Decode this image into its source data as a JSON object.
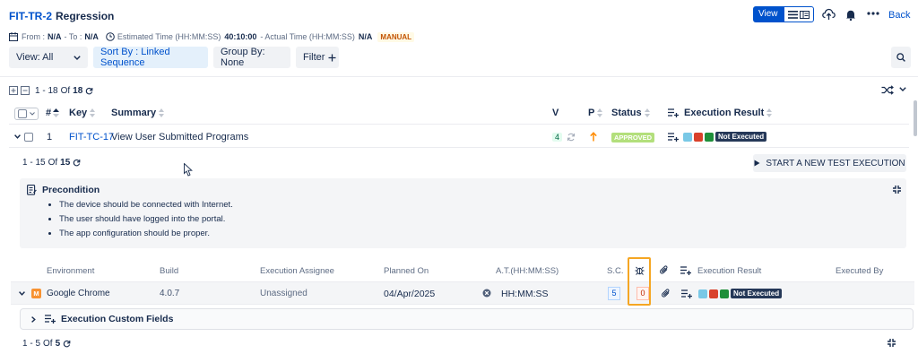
{
  "header": {
    "key": "FIT-TR-2",
    "title": "Regression",
    "from_label": "From :",
    "from_value": "N/A",
    "to_label": "- To :",
    "to_value": "N/A",
    "est_label": "Estimated Time (HH:MM:SS)",
    "est_value": "40:10:00",
    "actual_label": "- Actual Time (HH:MM:SS)",
    "actual_value": "N/A",
    "type_badge": "MANUAL",
    "view_label": "View",
    "back_label": "Back"
  },
  "toolbar": {
    "view_filter": "View: All",
    "sort_by": "Sort By : Linked Sequence",
    "group_by": "Group By: None",
    "filter": "Filter"
  },
  "pagination": {
    "range": "1 - 18",
    "of": "Of",
    "total": "18"
  },
  "columns": {
    "num": "#",
    "key": "Key",
    "summary": "Summary",
    "v": "V",
    "p": "P",
    "status": "Status",
    "execution_result": "Execution Result"
  },
  "test_case": {
    "index": "1",
    "key": "FIT-TC-17",
    "summary": "View User Submitted Programs",
    "version": "4",
    "status": "APPROVED",
    "result": "Not Executed"
  },
  "executions": {
    "range": "1 - 15",
    "of": "Of",
    "total": "15",
    "start_button": "START A NEW TEST EXECUTION",
    "precondition_title": "Precondition",
    "preconditions": [
      "The device should be connected with Internet.",
      "The user should have logged into the portal.",
      "The app configuration should be proper."
    ],
    "columns": {
      "environment": "Environment",
      "build": "Build",
      "assignee": "Execution Assignee",
      "planned_on": "Planned On",
      "at": "A.T.(HH:MM:SS)",
      "sc": "S.C.",
      "result": "Execution Result",
      "executed_by": "Executed By"
    },
    "row": {
      "env_badge": "M",
      "environment": "Google Chrome",
      "build": "4.0.7",
      "assignee": "Unassigned",
      "planned_on": "04/Apr/2025",
      "at": "HH:MM:SS",
      "sc": "5",
      "defects": "0",
      "result": "Not Executed"
    },
    "custom_fields": "Execution Custom Fields",
    "sub_range": "1 - 5",
    "sub_of": "Of",
    "sub_total": "5"
  },
  "colors": {
    "primary": "#0052cc",
    "approved": "#abf5d1",
    "manual_badge": "#fffae6",
    "highlight": "#f5a623",
    "status_light": "#79c8e6",
    "status_red": "#d9412b",
    "status_green": "#1f8f3a"
  }
}
